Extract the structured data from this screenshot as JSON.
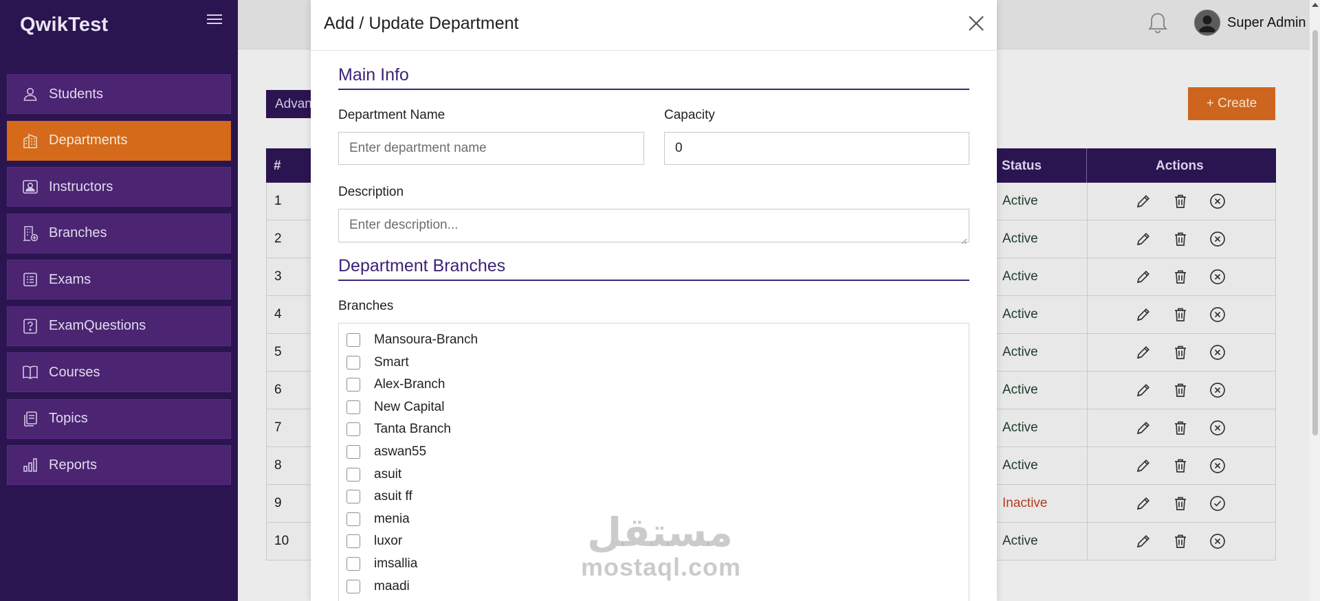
{
  "app": {
    "brand": "QwikTest"
  },
  "sidebar": {
    "items": [
      {
        "label": "Students",
        "icon": "user-icon",
        "active": false
      },
      {
        "label": "Departments",
        "icon": "building-icon",
        "active": true
      },
      {
        "label": "Instructors",
        "icon": "id-card-icon",
        "active": false
      },
      {
        "label": "Branches",
        "icon": "branch-building-icon",
        "active": false
      },
      {
        "label": "Exams",
        "icon": "document-icon",
        "active": false
      },
      {
        "label": "ExamQuestions",
        "icon": "question-icon",
        "active": false
      },
      {
        "label": "Courses",
        "icon": "book-icon",
        "active": false
      },
      {
        "label": "Topics",
        "icon": "stack-icon",
        "active": false
      },
      {
        "label": "Reports",
        "icon": "bar-chart-icon",
        "active": false
      }
    ]
  },
  "header": {
    "user_name": "Super Admin"
  },
  "page": {
    "advanced_label": "Advan",
    "create_label": "+ Create",
    "table": {
      "columns": {
        "num": "#",
        "status": "Status",
        "actions": "Actions"
      },
      "rows": [
        {
          "num": "1",
          "status": "Active"
        },
        {
          "num": "2",
          "status": "Active"
        },
        {
          "num": "3",
          "status": "Active"
        },
        {
          "num": "4",
          "status": "Active"
        },
        {
          "num": "5",
          "status": "Active"
        },
        {
          "num": "6",
          "status": "Active"
        },
        {
          "num": "7",
          "status": "Active"
        },
        {
          "num": "8",
          "status": "Active"
        },
        {
          "num": "9",
          "status": "Inactive"
        },
        {
          "num": "10",
          "status": "Active"
        }
      ]
    }
  },
  "modal": {
    "title": "Add / Update Department",
    "main_info_title": "Main Info",
    "department_name_label": "Department Name",
    "department_name_placeholder": "Enter department name",
    "capacity_label": "Capacity",
    "capacity_value": "0",
    "description_label": "Description",
    "description_placeholder": "Enter description...",
    "branches_section_title": "Department Branches",
    "branches_label": "Branches",
    "branches": [
      "Mansoura-Branch",
      "Smart",
      "Alex-Branch",
      "New Capital",
      "Tanta Branch",
      "aswan55",
      "asuit",
      "asuit ff",
      "menia",
      "luxor",
      "imsallia",
      "maadi"
    ]
  },
  "watermark": {
    "arabic": "مستقل",
    "latin": "mostaql.com"
  },
  "colors": {
    "sidebar": "#2a1550",
    "nav_item": "#4b2472",
    "accent": "#d46a1a",
    "section": "#3b2376",
    "inactive": "#b33a1e"
  }
}
